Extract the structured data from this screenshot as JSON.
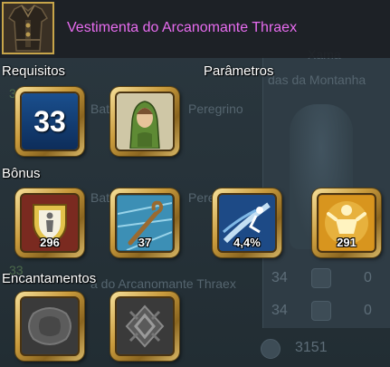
{
  "background": {
    "header_text": "Xama",
    "subtitle": "das da Montanha",
    "ghost_1": "Bata",
    "ghost_2": "Peregrino",
    "ghost_3": "Bata",
    "ghost_4": "Pere",
    "ghost_5": "a do Arcanomante Thraex",
    "rows": [
      {
        "left": "34",
        "right": "0"
      },
      {
        "left": "34",
        "right": "0"
      }
    ],
    "bottom_value": "3151",
    "side_num_1": "33",
    "side_num_2": "33"
  },
  "item": {
    "name": "Vestimenta do Arcanomante Thraex",
    "name_color": "#e86cf0",
    "icon": "robe-armor-icon"
  },
  "sections": {
    "requirements": "Requisitos",
    "parameters": "Parâmetros",
    "bonus": "Bônus",
    "enchantments": "Encantamentos"
  },
  "requirements": {
    "level": "33",
    "class_icon": "peregrino-class-icon"
  },
  "bonuses": [
    {
      "icon": "shield-defense-icon",
      "value": "296"
    },
    {
      "icon": "staff-magic-icon",
      "value": "37"
    },
    {
      "icon": "speed-dash-icon",
      "value": "4,4%"
    },
    {
      "icon": "strength-body-icon",
      "value": "291"
    }
  ],
  "enchantments": [
    {
      "icon": "empty-socket-icon"
    },
    {
      "icon": "rune-socket-icon"
    }
  ]
}
